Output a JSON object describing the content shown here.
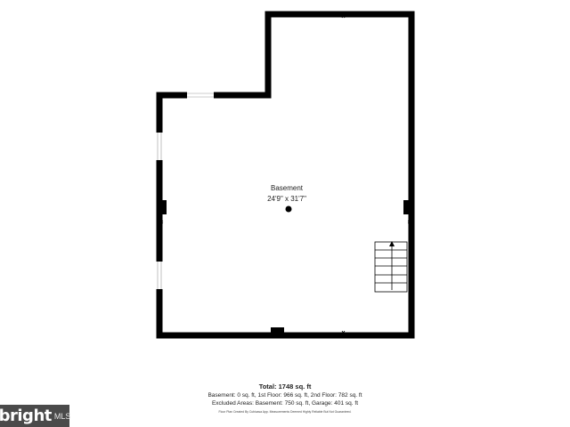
{
  "room": {
    "name": "Basement",
    "dimensions": "24'9\" x 31'7\""
  },
  "totals": {
    "title": "Total: 1748 sq. ft",
    "breakdown": "Basement: 0 sq. ft, 1st Floor: 966 sq. ft, 2nd Floor: 782 sq. ft",
    "excluded": "Excluded Areas: Basement: 750 sq. ft, Garage: 401 sq. ft",
    "disclaimer": "Floor Plan Created By Cubicasa App. Measurements Deemed Highly Reliable But Not Guaranteed."
  },
  "logo": {
    "text": "bright",
    "suffix": "MLS"
  },
  "colors": {
    "wall": "#000000",
    "logo_bg": "#4a4a4a"
  },
  "icons": {
    "stair_arrow": "arrow-up-icon",
    "room_marker": "dot-icon"
  }
}
